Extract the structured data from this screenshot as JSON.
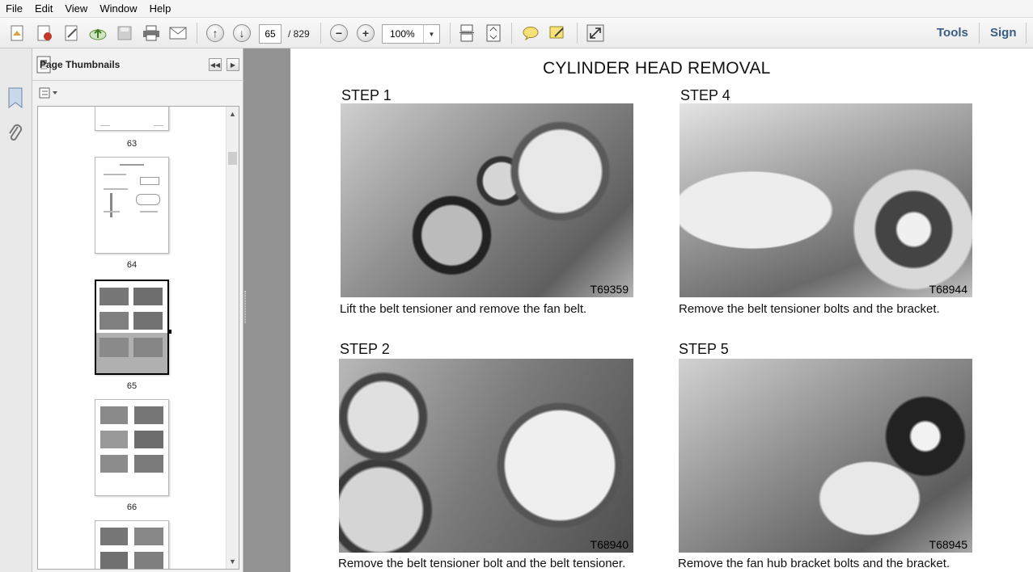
{
  "menu": [
    "File",
    "Edit",
    "View",
    "Window",
    "Help"
  ],
  "toolbar": {
    "page_current": "65",
    "page_total": "/ 829",
    "zoom": "100%",
    "tools_label": "Tools",
    "sign_label": "Sign"
  },
  "sidebar": {
    "panel_title": "Page Thumbnails",
    "thumbnails": [
      {
        "label": "63"
      },
      {
        "label": "64"
      },
      {
        "label": "65"
      },
      {
        "label": "66"
      }
    ]
  },
  "document": {
    "title": "CYLINDER HEAD REMOVAL",
    "steps": [
      {
        "heading": "STEP 1",
        "code": "T69359",
        "caption": "Lift the belt tensioner and remove the fan belt."
      },
      {
        "heading": "STEP 4",
        "code": "T68944",
        "caption": "Remove the belt tensioner bolts and the bracket."
      },
      {
        "heading": "STEP 2",
        "code": "T68940",
        "caption": "Remove the belt tensioner bolt and the belt tensioner."
      },
      {
        "heading": "STEP 5",
        "code": "T68945",
        "caption": "Remove the fan hub bracket bolts and the bracket."
      }
    ]
  },
  "colors": {
    "splitter": "#939393",
    "link": "#3a5c86",
    "selected_thumb": "#000000"
  }
}
